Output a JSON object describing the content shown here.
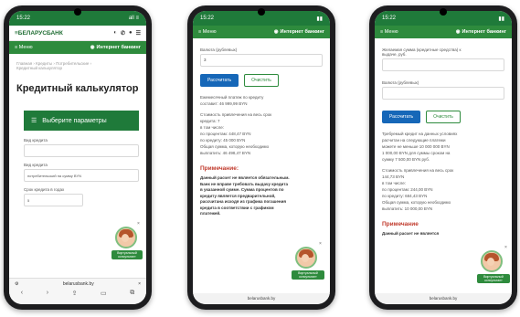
{
  "phone1": {
    "status_time": "15:22",
    "status_icons": "all ≡",
    "bank_logo": "≡БЕЛАРУСБАНК",
    "menu_label": "≡ Меню",
    "nav_right": "Интернет банкинг",
    "breadcrumb_line1": "Главная › Кредиты › Потребительские ›",
    "breadcrumb_line2": "Кредитный калькулятор",
    "page_title": "Кредитный калькулятор",
    "select_params_label": "Выберите параметры",
    "field1_label": "Вид кредита",
    "field2_label": "Вид кредита",
    "field2_value": "потребительский на сумму BYN",
    "field3_label": "Срок кредита в годах",
    "field3_value": "5",
    "url": "belarusbank.by",
    "assistant_label": "Виртуальный консультант"
  },
  "phone2": {
    "status_time": "15:22",
    "menu_label": "≡ Меню",
    "nav_right": "Интернет банкинг",
    "field_label": "Валюта (рублевых)",
    "field_value": "3",
    "calculate_label": "Рассчитать",
    "reset_label": "Очистить",
    "results": [
      "Ежемесячный платеж по кредиту",
      "составит: 46 999,99 BYN",
      "Стоимость привлечения на весь срок",
      "кредита: 7",
      "в том числе:",
      "по процентам: 448,47 BYN",
      "по кредиту: 45 000 BYN",
      "Общая сумма, которую необходимо",
      "выплатить: 46 498,47 BYN"
    ],
    "notes_title": "Примечание:",
    "note_text": "Данный расчет не является обязательным. Банк не вправе требовать выдачу кредита в указанной сумме. Сумма процентов по кредиту является предварительной, рассчитана исходя из графика погашения кредита в соответствии с графиком платежей.",
    "url": "belarusbank.by",
    "assistant_label": "Виртуальный консультант"
  },
  "phone3": {
    "status_time": "15:22",
    "menu_label": "≡ Меню",
    "nav_right": "Интернет банкинг",
    "field1_label": "Желаемая сумма (кредитные средства) к выдаче, руб.",
    "field2_label": "Валюта (рублевых)",
    "calculate_label": "Рассчитать",
    "reset_label": "Очистить",
    "results": [
      "Требуемый кредит на данных условиях",
      "расчитан на следующие платежи",
      "можете не меньше 10 000 000 BYN",
      "1 000,00 BYN для суммы сроком на",
      "сумму 7 500,00 BYN руб.",
      "",
      "Стоимость привлечения на весь срок",
      "144,73 BYN",
      "в том числе:",
      "по процентам: 244,00 BYN",
      "по кредиту: 684,43 BYN",
      "Общая сумма, которую необходимо",
      "выплатить: 10 000,00 BYN"
    ],
    "notes_title": "Примечание",
    "note_text": "Данный расчет не является",
    "url": "belarusbank.by",
    "assistant_label": "Виртуальный консультант"
  },
  "colors": {
    "brand_green": "#1f7a3a",
    "nav_green": "#2e8b3d",
    "primary_blue": "#1667b8",
    "note_red": "#c0392b"
  }
}
